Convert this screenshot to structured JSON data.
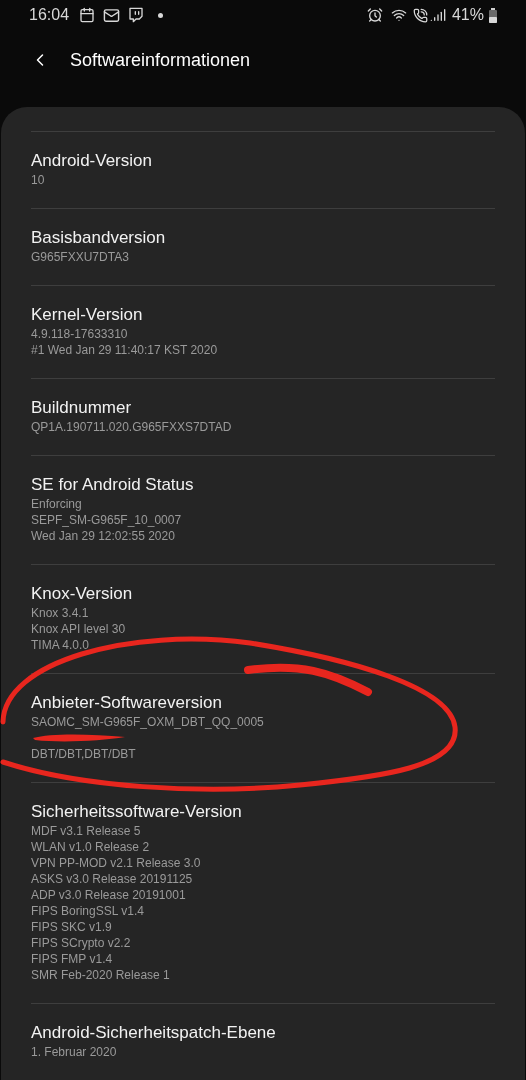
{
  "status_bar": {
    "time": "16:04",
    "battery": "41%"
  },
  "header": {
    "title": "Softwareinformationen"
  },
  "items": [
    {
      "title": "Android-Version",
      "details": [
        {
          "kind": "text",
          "text": "10"
        }
      ]
    },
    {
      "title": "Basisbandversion",
      "details": [
        {
          "kind": "text",
          "text": "G965FXXU7DTA3"
        }
      ]
    },
    {
      "title": "Kernel-Version",
      "details": [
        {
          "kind": "text",
          "text": "4.9.118-17633310"
        },
        {
          "kind": "text",
          "text": "#1 Wed Jan 29 11:40:17 KST 2020"
        }
      ]
    },
    {
      "title": "Buildnummer",
      "details": [
        {
          "kind": "text",
          "text": "QP1A.190711.020.G965FXXS7DTAD"
        }
      ]
    },
    {
      "title": "SE for Android Status",
      "details": [
        {
          "kind": "text",
          "text": "Enforcing"
        },
        {
          "kind": "text",
          "text": "SEPF_SM-G965F_10_0007"
        },
        {
          "kind": "text",
          "text": "Wed Jan 29 12:02:55 2020"
        }
      ]
    },
    {
      "title": "Knox-Version",
      "details": [
        {
          "kind": "text",
          "text": "Knox 3.4.1"
        },
        {
          "kind": "text",
          "text": "Knox API level 30"
        },
        {
          "kind": "text",
          "text": "TIMA 4.0.0"
        }
      ]
    },
    {
      "title": "Anbieter-Softwareversion",
      "details": [
        {
          "kind": "text",
          "text": "SAOMC_SM-G965F_OXM_DBT_QQ_0005"
        },
        {
          "kind": "redaction"
        },
        {
          "kind": "text",
          "text": "DBT/DBT,DBT/DBT"
        }
      ]
    },
    {
      "title": "Sicherheitssoftware-Version",
      "details": [
        {
          "kind": "text",
          "text": "MDF v3.1 Release 5"
        },
        {
          "kind": "text",
          "text": "WLAN v1.0 Release 2"
        },
        {
          "kind": "text",
          "text": "VPN PP-MOD v2.1 Release 3.0"
        },
        {
          "kind": "text",
          "text": "ASKS v3.0 Release 20191125"
        },
        {
          "kind": "text",
          "text": "ADP v3.0 Release 20191001"
        },
        {
          "kind": "text",
          "text": "FIPS BoringSSL v1.4"
        },
        {
          "kind": "text",
          "text": "FIPS SKC v1.9"
        },
        {
          "kind": "text",
          "text": "FIPS SCrypto v2.2"
        },
        {
          "kind": "text",
          "text": "FIPS FMP v1.4"
        },
        {
          "kind": "text",
          "text": "SMR Feb-2020 Release 1"
        }
      ]
    },
    {
      "title": "Android-Sicherheitspatch-Ebene",
      "details": [
        {
          "kind": "text",
          "text": "1. Februar 2020"
        }
      ]
    }
  ]
}
